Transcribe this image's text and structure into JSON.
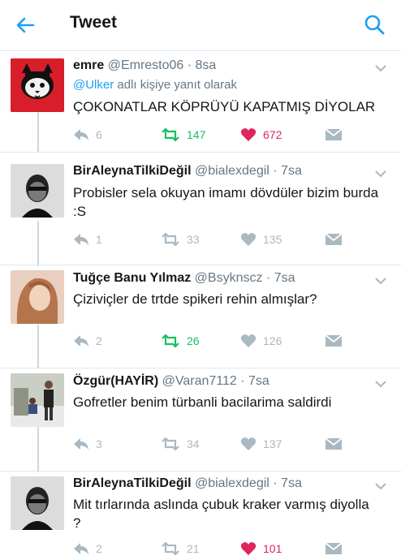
{
  "header": {
    "title": "Tweet"
  },
  "colors": {
    "accent": "#1da1f2",
    "retweeted": "#17bf63",
    "liked": "#e0245e",
    "muted": "#aab8c2"
  },
  "tweets": [
    {
      "name": "emre",
      "handle": "@Emresto06 · 8sa",
      "reply_mention": "@Ulker",
      "reply_suffix": " adlı kişiye yanıt olarak",
      "text": "ÇOKONATLAR KÖPRÜYÜ KAPATMIŞ DİYOLAR",
      "replies": "6",
      "retweets": "147",
      "likes": "672",
      "retweeted": true,
      "liked": true
    },
    {
      "name": "BirAleynaTilkiDeğil",
      "handle": "@bialexdegil · 7sa",
      "text": "Probisler sela okuyan imamı dövdüler bizim burda :S",
      "replies": "1",
      "retweets": "33",
      "likes": "135",
      "retweeted": false,
      "liked": false
    },
    {
      "name": "Tuğçe Banu Yılmaz",
      "handle": "@Bsyknscz · 7sa",
      "text": "Çiziviçler de trtde spikeri rehin almışlar?",
      "replies": "2",
      "retweets": "26",
      "likes": "126",
      "retweeted": true,
      "liked": false
    },
    {
      "name": "Özgür(HAYİR)",
      "handle": "@Varan7112 · 7sa",
      "text": "Gofretler benim türbanli bacilarima saldirdi",
      "replies": "3",
      "retweets": "34",
      "likes": "137",
      "retweeted": false,
      "liked": false
    },
    {
      "name": "BirAleynaTilkiDeğil",
      "handle": "@bialexdegil · 7sa",
      "text": "Mit tırlarında aslında çubuk kraker varmış diyolla ?",
      "replies": "2",
      "retweets": "21",
      "likes": "101",
      "retweeted": false,
      "liked": true
    }
  ]
}
